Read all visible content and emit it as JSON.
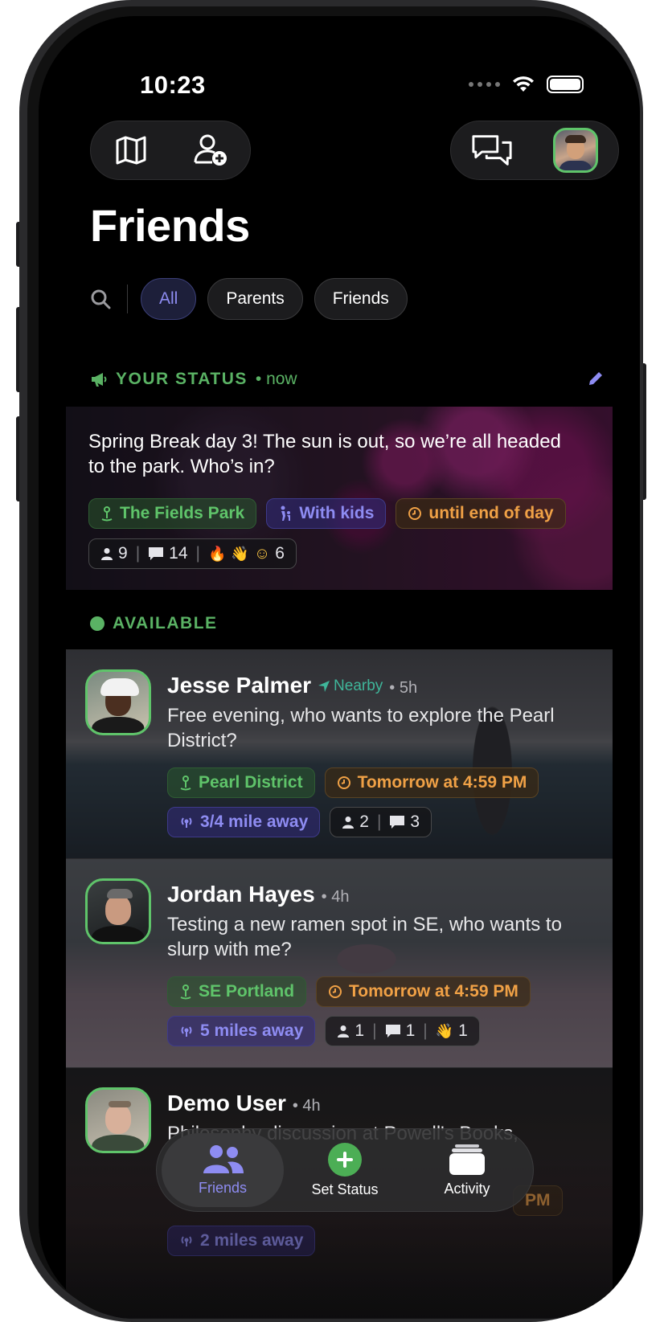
{
  "status_bar": {
    "time": "10:23"
  },
  "page": {
    "title": "Friends"
  },
  "filters": [
    {
      "label": "All",
      "active": true
    },
    {
      "label": "Parents",
      "active": false
    },
    {
      "label": "Friends",
      "active": false
    }
  ],
  "your_status": {
    "header": "YOUR STATUS",
    "time": "• now",
    "message": "Spring Break day 3! The sun is out, so we’re all headed to the park. Who’s in?",
    "tags": {
      "location": "The Fields Park",
      "kids": "With kids",
      "until": "until end of day"
    },
    "stats": {
      "people": "9",
      "comments": "14",
      "reactions": "6"
    }
  },
  "available": {
    "header": "AVAILABLE",
    "friends": [
      {
        "name": "Jesse Palmer",
        "nearby": "Nearby",
        "time": "• 5h",
        "message": "Free evening, who wants to explore the Pearl District?",
        "location": "Pearl District",
        "when": "Tomorrow at 4:59 PM",
        "distance": "3/4 mile away",
        "people": "2",
        "comments": "3"
      },
      {
        "name": "Jordan Hayes",
        "time": "• 4h",
        "message": "Testing a new ramen spot in SE, who wants to slurp with me?",
        "location": "SE Portland",
        "when": "Tomorrow at 4:59 PM",
        "distance": "5 miles away",
        "people": "1",
        "comments": "1",
        "reactions": "1"
      },
      {
        "name": "Demo User",
        "time": "• 4h",
        "message": "Philosophy discussion at Powell's Books,",
        "when_partial": "PM",
        "distance": "2 miles away"
      }
    ]
  },
  "tabbar": [
    {
      "label": "Friends",
      "active": true
    },
    {
      "label": "Set Status",
      "active": false
    },
    {
      "label": "Activity",
      "active": false
    }
  ],
  "colors": {
    "accent_purple": "#8e8cf2",
    "accent_green": "#5fc46a",
    "accent_orange": "#f0a146",
    "background": "#000000"
  },
  "icons": [
    "map-icon",
    "add-friend-icon",
    "chat-icon",
    "search-icon",
    "megaphone-icon",
    "pencil-icon",
    "pin-icon",
    "walking-kid-icon",
    "clock-icon",
    "person-icon",
    "comment-icon",
    "fire-icon",
    "wave-icon",
    "smile-icon",
    "location-arrow-icon",
    "signal-icon",
    "friends-icon",
    "plus-icon",
    "activity-stack-icon"
  ]
}
